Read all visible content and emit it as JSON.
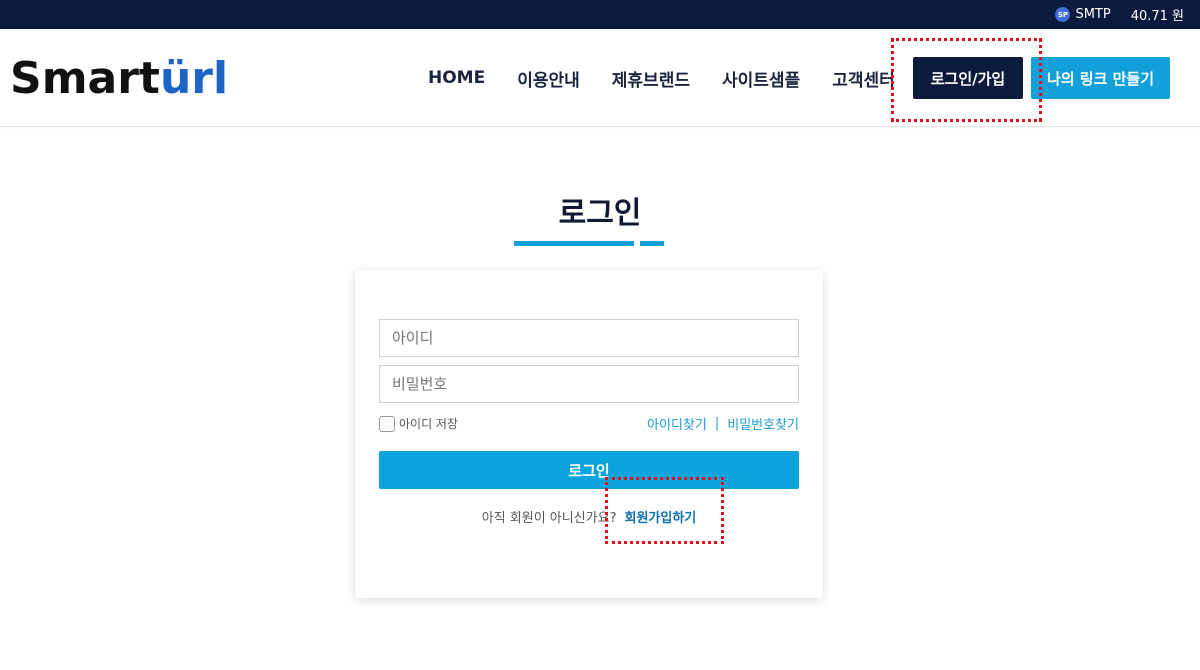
{
  "topbar": {
    "sp_icon_label": "SP",
    "smtp_label": "SMTP",
    "balance": "40.71 원"
  },
  "header": {
    "logo_part_1": "Smart",
    "logo_part_2": "ürl",
    "nav": [
      {
        "label": "HOME"
      },
      {
        "label": "이용안내"
      },
      {
        "label": "제휴브랜드"
      },
      {
        "label": "사이트샘플"
      },
      {
        "label": "고객센터"
      }
    ],
    "login_join_label": "로그인/가입",
    "make_link_label": "나의 링크 만들기"
  },
  "login": {
    "title": "로그인",
    "id_placeholder": "아이디",
    "pw_placeholder": "비밀번호",
    "remember_label": "아이디 저장",
    "find_id_label": "아이디찾기",
    "find_separator": "|",
    "find_pw_label": "비밀번호찾기",
    "submit_label": "로그인",
    "signup_prompt": "아직 회원이 아니신가요?",
    "signup_link": "회원가입하기"
  },
  "colors": {
    "navy": "#0c1a3d",
    "accent_blue": "#12a0da",
    "highlight_red": "#e0101b"
  },
  "icons": {
    "topbar_icon": "sp-coin-icon"
  }
}
